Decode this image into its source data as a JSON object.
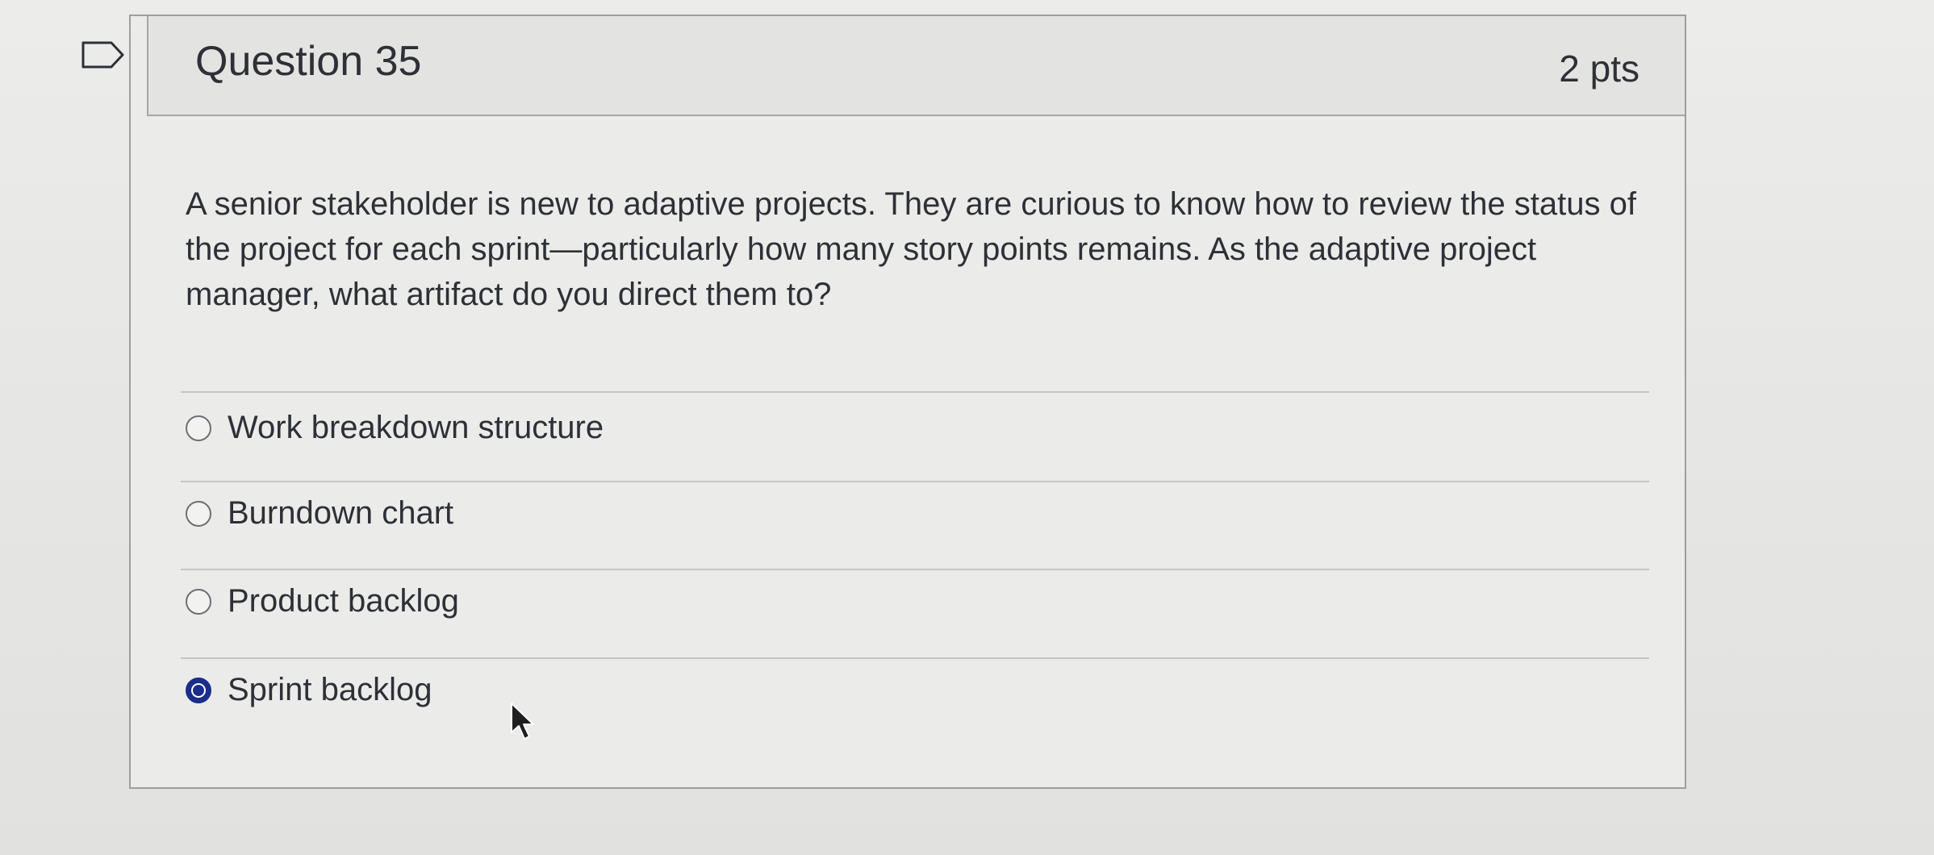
{
  "question": {
    "title": "Question 35",
    "points": "2 pts",
    "text": "A senior stakeholder is new to adaptive projects. They are curious to know how to review the status of the project for each sprint—particularly how many story points remains. As the adaptive project manager, what artifact do you direct them to?"
  },
  "answers": [
    {
      "label": "Work breakdown structure",
      "selected": false
    },
    {
      "label": "Burndown chart",
      "selected": false
    },
    {
      "label": "Product backlog",
      "selected": false
    },
    {
      "label": "Sprint backlog",
      "selected": true
    }
  ],
  "colors": {
    "selected_radio": "#1b2e8a",
    "text": "#2d3036",
    "card_border": "#9e9e9c"
  },
  "icons": {
    "flag": "flag-icon",
    "cursor": "mouse-pointer-icon"
  }
}
